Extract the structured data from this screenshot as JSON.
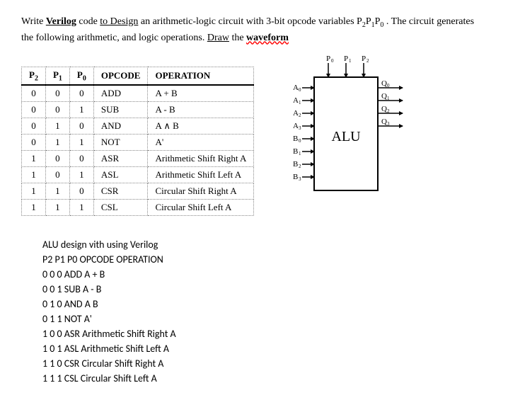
{
  "prompt": {
    "text1": "Write ",
    "text2": "Verilog",
    "text3": " code ",
    "text4": "to  Design",
    "text5": " an arithmetic-logic circuit with 3-bit opcode variables P",
    "text6": "2",
    "text7": "P",
    "text8": "1",
    "text9": "P",
    "text10": "0",
    "text11": " . The circuit generates the following arithmetic, and logic operations. ",
    "text12": "Draw",
    "text13": " the ",
    "text14": "waveform"
  },
  "table": {
    "headers": {
      "p2": "P",
      "p2sub": "2",
      "p1": "P",
      "p1sub": "1",
      "p0": "P",
      "p0sub": "0",
      "opcode": "OPCODE",
      "operation": "OPERATION"
    },
    "rows": [
      {
        "p2": "0",
        "p1": "0",
        "p0": "0",
        "opcode": "ADD",
        "operation": "A + B"
      },
      {
        "p2": "0",
        "p1": "0",
        "p0": "1",
        "opcode": "SUB",
        "operation": "A - B"
      },
      {
        "p2": "0",
        "p1": "1",
        "p0": "0",
        "opcode": "AND",
        "operation": "A ∧ B"
      },
      {
        "p2": "0",
        "p1": "1",
        "p0": "1",
        "opcode": "NOT",
        "operation": "A'"
      },
      {
        "p2": "1",
        "p1": "0",
        "p0": "0",
        "opcode": "ASR",
        "operation": "Arithmetic Shift Right A"
      },
      {
        "p2": "1",
        "p1": "0",
        "p0": "1",
        "opcode": "ASL",
        "operation": "Arithmetic Shift Left A"
      },
      {
        "p2": "1",
        "p1": "1",
        "p0": "0",
        "opcode": "CSR",
        "operation": "Circular Shift Right A"
      },
      {
        "p2": "1",
        "p1": "1",
        "p0": "1",
        "opcode": "CSL",
        "operation": "Circular Shift Left A"
      }
    ]
  },
  "alu": {
    "label": "ALU",
    "inputs_top": [
      "P",
      "P",
      "P"
    ],
    "inputs_top_sub": [
      "0",
      "1",
      "2"
    ],
    "inputs_left": [
      "A",
      "A",
      "A",
      "A",
      "B",
      "B",
      "B",
      "B"
    ],
    "inputs_left_sub": [
      "0",
      "1",
      "2",
      "3",
      "0",
      "1",
      "2",
      "3"
    ],
    "outputs_right": [
      "Q",
      "Q",
      "Q",
      "Q"
    ],
    "outputs_right_sub": [
      "0",
      "1",
      "2",
      "3"
    ]
  },
  "summary": {
    "line1": "ALU design vith using Verilog",
    "line2": "P2 P1 P0 OPCODE OPERATION",
    "line3": "0 0 0 ADD A + B",
    "line4": "0 0 1 SUB A - B",
    "line5": "0 1 0 AND A    B",
    "line6": "0 1 1 NOT A'",
    "line7": "1 0 0 ASR Arithmetic Shift Right A",
    "line8": "1 0 1 ASL Arithmetic Shift Left A",
    "line9": "1 1 0 CSR Circular Shift Right A",
    "line10": "1 1 1 CSL Circular Shift Left A"
  }
}
